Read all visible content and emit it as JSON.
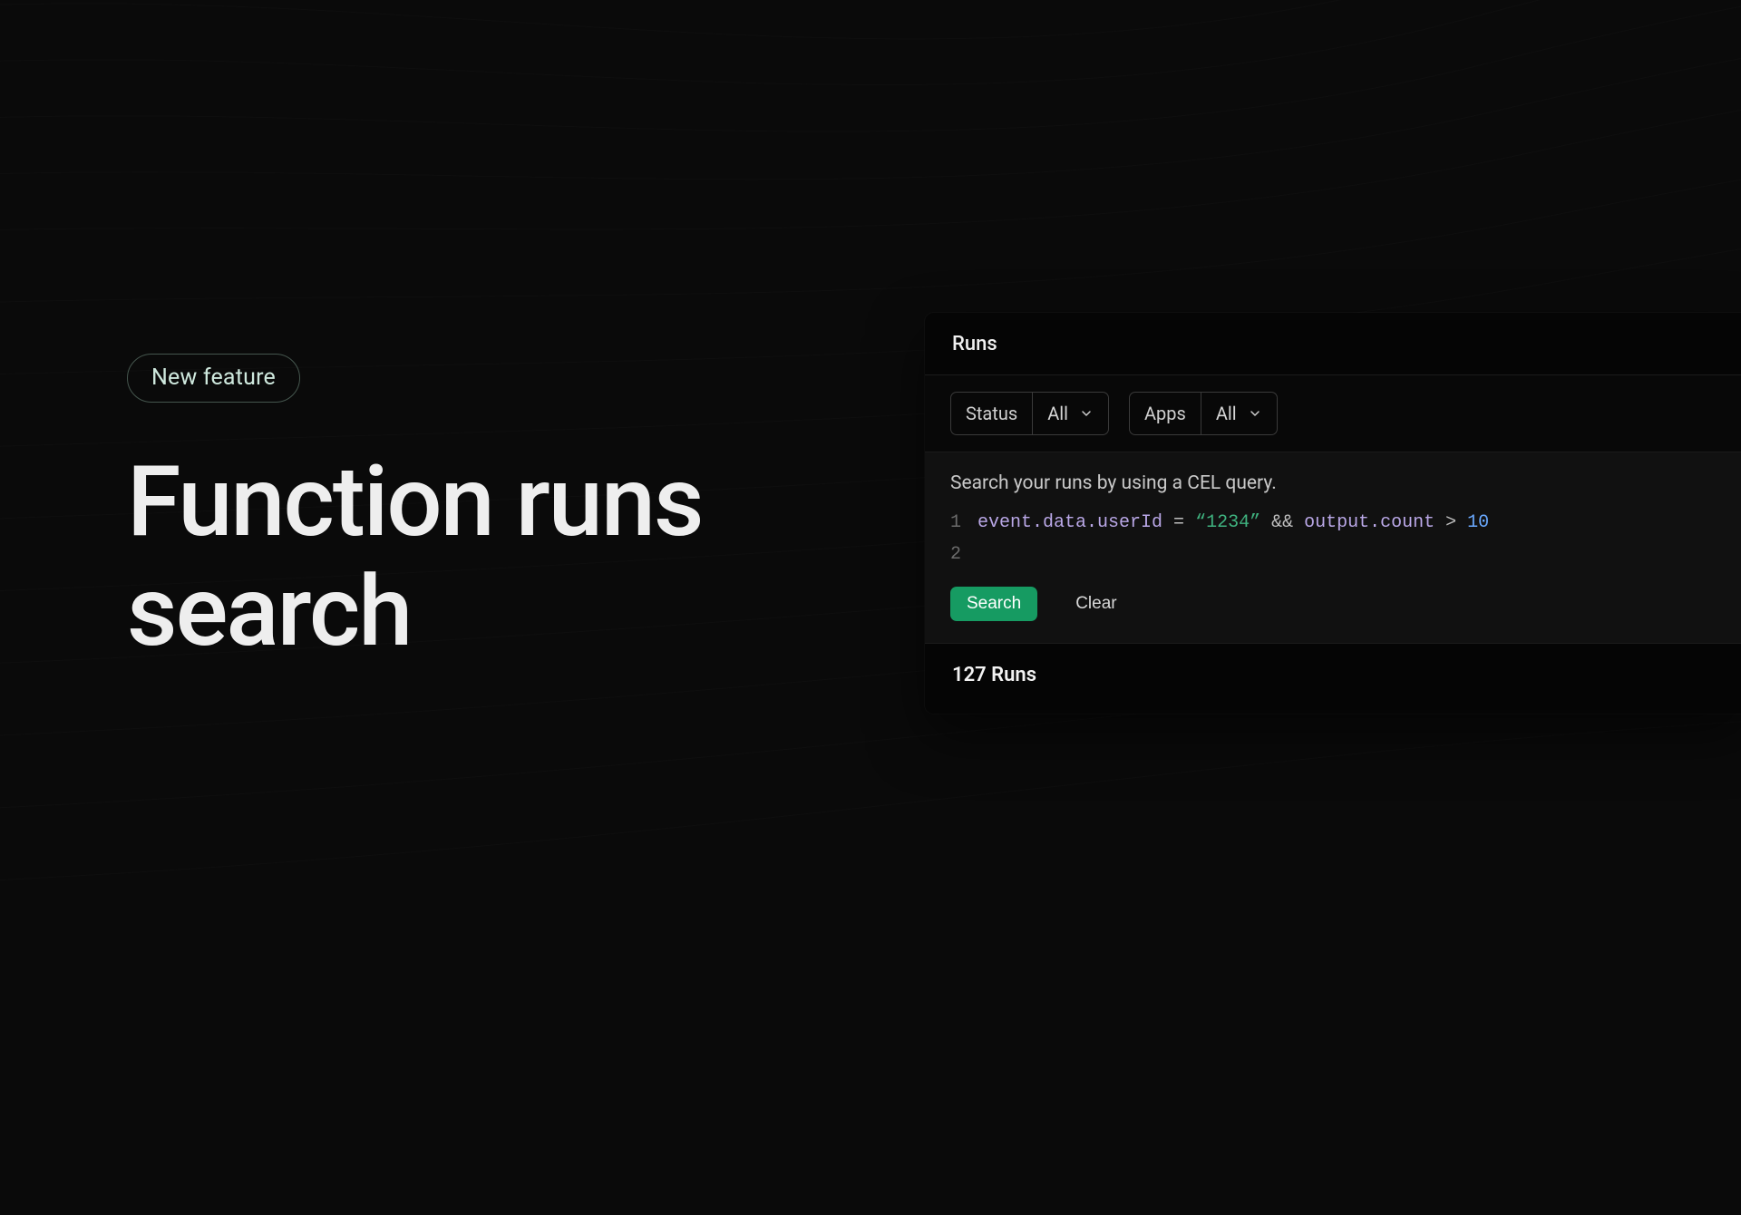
{
  "hero": {
    "badge": "New feature",
    "title_line1": "Function runs",
    "title_line2": "search"
  },
  "panel": {
    "tab_label": "Runs",
    "filters": {
      "status": {
        "label": "Status",
        "value": "All"
      },
      "apps": {
        "label": "Apps",
        "value": "All"
      }
    },
    "query": {
      "hint": "Search your runs by using a CEL query.",
      "lines": {
        "ln1": "1",
        "ln2": "2",
        "l1_t1": "event.data.userId",
        "l1_t2": " = ",
        "l1_t3": "“1234”",
        "l1_t4": " && ",
        "l1_t5": "output.count",
        "l1_t6": " > ",
        "l1_t7": "10"
      }
    },
    "actions": {
      "search": "Search",
      "clear": "Clear"
    },
    "results": {
      "label": "127 Runs",
      "count": 127
    }
  },
  "colors": {
    "accent": "#169b62",
    "badge_ring": "rgba(180,230,205,0.35)"
  }
}
